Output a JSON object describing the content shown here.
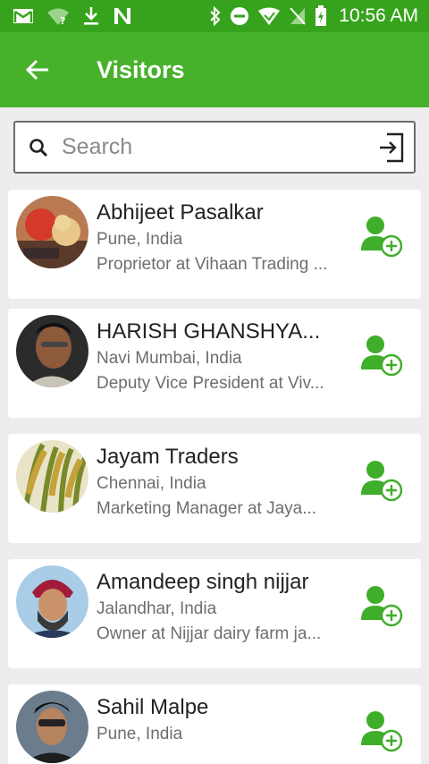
{
  "status_bar": {
    "time": "10:56 AM",
    "icons": [
      "gmail-icon",
      "wifi-unknown-icon",
      "download-icon",
      "n-app-icon",
      "bluetooth-icon",
      "dnd-icon",
      "signal-icon",
      "no-sim-icon",
      "battery-charging-icon"
    ]
  },
  "app_bar": {
    "title": "Visitors",
    "back_icon": "arrow-back-icon"
  },
  "search": {
    "placeholder": "Search",
    "value": ""
  },
  "colors": {
    "status_bar": "#37a31c",
    "app_bar": "#48b12c",
    "accent": "#3fae2a"
  },
  "visitors": [
    {
      "name": "Abhijeet Pasalkar",
      "location": "Pune, India",
      "title": "Proprietor at Vihaan Trading ..."
    },
    {
      "name": "HARISH GHANSHYA...",
      "location": "Navi Mumbai, India",
      "title": "Deputy Vice President at Viv..."
    },
    {
      "name": "Jayam Traders",
      "location": "Chennai, India",
      "title": "Marketing Manager at Jaya..."
    },
    {
      "name": "Amandeep singh nijjar",
      "location": "Jalandhar, India",
      "title": "Owner at Nijjar dairy farm ja..."
    },
    {
      "name": "Sahil Malpe",
      "location": "Pune, India",
      "title": ""
    }
  ]
}
